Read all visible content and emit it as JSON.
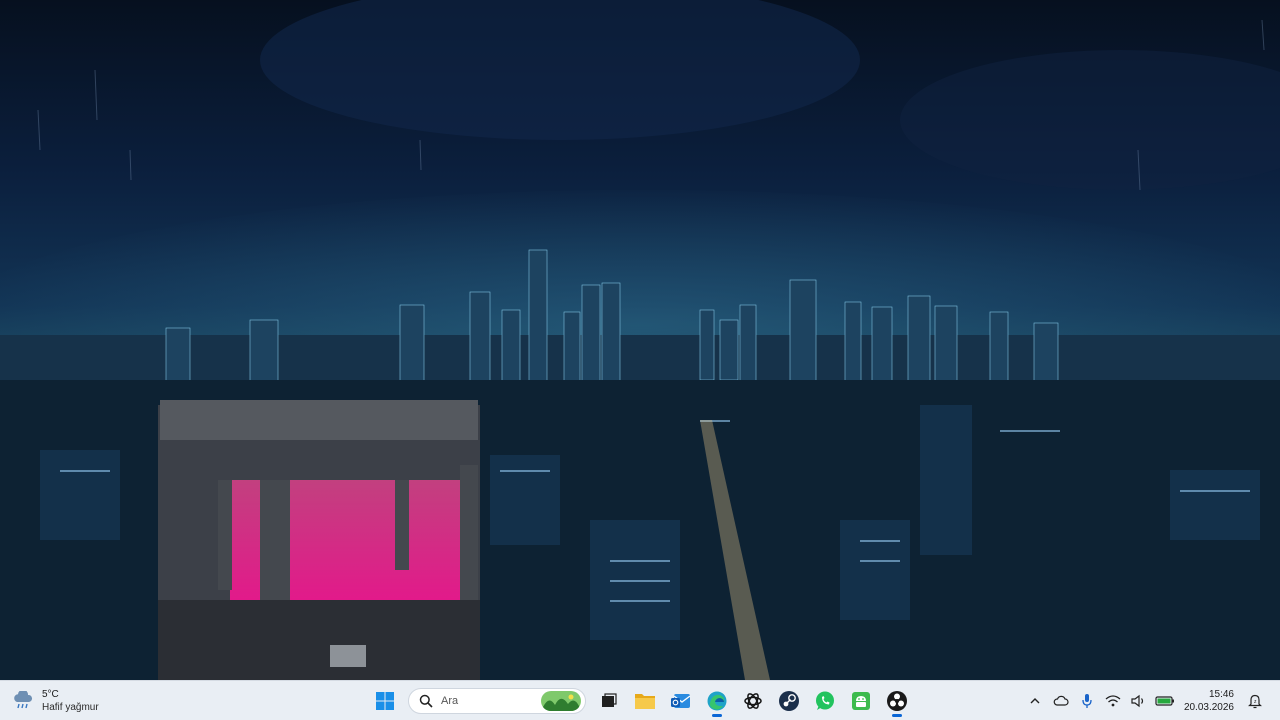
{
  "taskbar": {
    "weather": {
      "temperature": "5°C",
      "condition": "Hafif yağmur",
      "icon": "cloud-rain-icon"
    },
    "search": {
      "placeholder": "Ara"
    },
    "pinned_apps": [
      {
        "name": "start-button",
        "icon": "windows-logo-icon"
      },
      {
        "name": "task-view-button",
        "icon": "task-view-icon"
      },
      {
        "name": "file-explorer-button",
        "icon": "folder-icon"
      },
      {
        "name": "outlook-button",
        "icon": "mail-icon"
      },
      {
        "name": "edge-browser-button",
        "icon": "edge-icon"
      },
      {
        "name": "chatgpt-button",
        "icon": "openai-icon"
      },
      {
        "name": "steam-button",
        "icon": "steam-icon"
      },
      {
        "name": "whatsapp-button",
        "icon": "whatsapp-icon"
      },
      {
        "name": "android-app-button",
        "icon": "android-icon"
      },
      {
        "name": "obs-studio-button",
        "icon": "obs-icon"
      }
    ],
    "tray": {
      "icons": [
        "chevron-up-icon",
        "onedrive-cloud-icon",
        "microphone-icon",
        "wifi-icon",
        "volume-icon",
        "battery-icon"
      ],
      "time": "15:46",
      "date": "20.03.2026",
      "notification_icon": "notification-bell-icon"
    },
    "colors": {
      "background": "#e9eef4",
      "accent": "#0a66d6"
    }
  },
  "wallpaper": {
    "description_icon": "city-night-wallpaper"
  }
}
